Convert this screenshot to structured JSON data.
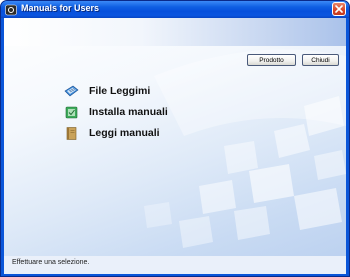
{
  "window": {
    "title": "Manuals for Users"
  },
  "toolbar": {
    "product_label": "Prodotto",
    "close_label": "Chiudi"
  },
  "menu": {
    "items": [
      {
        "label": "File Leggimi",
        "icon": "readme-file-icon"
      },
      {
        "label": "Installa manuali",
        "icon": "install-manuals-icon"
      },
      {
        "label": "Leggi manuali",
        "icon": "book-icon"
      }
    ]
  },
  "status_bar": {
    "text": "Effettuare una selezione."
  },
  "colors": {
    "titlebar": "#0a55e0",
    "close_button": "#d9482a",
    "client_background": "#c9dbf3"
  }
}
